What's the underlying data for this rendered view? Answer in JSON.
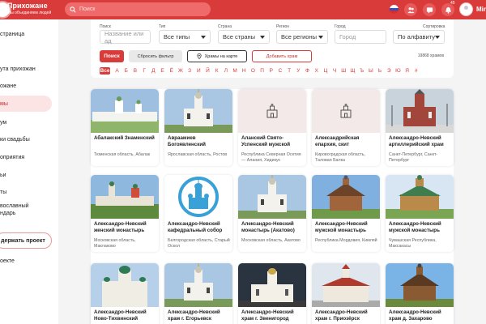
{
  "header": {
    "brand_title": "Прихожане",
    "brand_tagline": "Мы объединяем людей",
    "search_placeholder": "Поиск",
    "notification_count": "45",
    "user_name": "Mir"
  },
  "sidebar": {
    "items": [
      {
        "label": "страница"
      },
      {
        "label": "ута прихожан"
      },
      {
        "label": "ожане"
      },
      {
        "label": "мы",
        "active": true
      },
      {
        "label": "ум"
      },
      {
        "label": "ки свадьбы"
      },
      {
        "label": "оприятия"
      },
      {
        "label": "ьи"
      },
      {
        "label": "ты"
      },
      {
        "label": "вославный\nндарь"
      },
      {
        "label": "оекте"
      }
    ],
    "support_label": "держать проект"
  },
  "filters": {
    "search_field": {
      "label": "Поиск",
      "placeholder": "Название или ад"
    },
    "type_field": {
      "label": "Тип",
      "value": "Все типы"
    },
    "country_field": {
      "label": "Страна",
      "value": "Все страны"
    },
    "region_field": {
      "label": "Регион",
      "value": "Все регионы"
    },
    "city_field": {
      "label": "Город",
      "placeholder": "Город"
    },
    "sort_field": {
      "label": "Сортировка",
      "value": "По алфавиту"
    },
    "search_button": "Поиск",
    "reset_button": "Сбросить фильтр",
    "map_button": "Храмы на карте",
    "add_button": "Добавить храм",
    "count_text": "19868 храмов",
    "alphabet_all": "Все",
    "letters": [
      "А",
      "Б",
      "В",
      "Г",
      "Д",
      "Е",
      "Ё",
      "Ж",
      "З",
      "И",
      "Й",
      "К",
      "Л",
      "М",
      "Н",
      "О",
      "П",
      "Р",
      "С",
      "Т",
      "У",
      "Ф",
      "Х",
      "Ц",
      "Ч",
      "Ш",
      "Щ",
      "Ъ",
      "Ы",
      "Ь",
      "Э",
      "Ю",
      "Я",
      "#"
    ]
  },
  "temples": [
    {
      "title": "Абалакский Знаменский",
      "location": "Тюменская область, Абалак",
      "image": "monastery-wall"
    },
    {
      "title": "Авраамиев Богоявленский",
      "location": "Ярославская область, Ростов",
      "image": "white-church"
    },
    {
      "title": "Аланский Свято-Успенский мужской",
      "location": "Республика Северная Осетия — Алания, Хидикус",
      "image": "placeholder"
    },
    {
      "title": "Александрийская епархия, скит",
      "location": "Кировоградская область, Таловая Балка",
      "image": "placeholder"
    },
    {
      "title": "Александро-Невский артиллерийский храм",
      "location": "Санкт-Петербург, Санкт-Петербург",
      "image": "red-brick-church"
    },
    {
      "title": "Александро-Невский женский монастырь",
      "location": "Московская область, Маклаково",
      "image": "monastery-green"
    },
    {
      "title": "Александро-Невский кафедральный собор",
      "location": "Белгородская область, Старый Оскол",
      "image": "blue-logo"
    },
    {
      "title": "Александро-Невский монастырь (Акатово)",
      "location": "Московская область, Акатово",
      "image": "white-church"
    },
    {
      "title": "Александро-Невский мужской монастырь",
      "location": "Республика Мордовия, Кимляй",
      "image": "wooden-church"
    },
    {
      "title": "Александро-Невский мужской монастырь",
      "location": "Чувашская Республика, Максакасы",
      "image": "wooden-green"
    },
    {
      "title": "Александро-Невский Ново-Тихвинский",
      "location": "",
      "image": "white-cathedral"
    },
    {
      "title": "Александро-Невский храм г. Егорьевск",
      "location": "",
      "image": "white-church"
    },
    {
      "title": "Александро-Невский храм г. Звенигород",
      "location": "",
      "image": "white-night"
    },
    {
      "title": "Александро-Невский храм г. Приозёрск",
      "location": "",
      "image": "red-roof"
    },
    {
      "title": "Александро-Невский храм д. Захарово",
      "location": "",
      "image": "wooden-blue"
    }
  ]
}
